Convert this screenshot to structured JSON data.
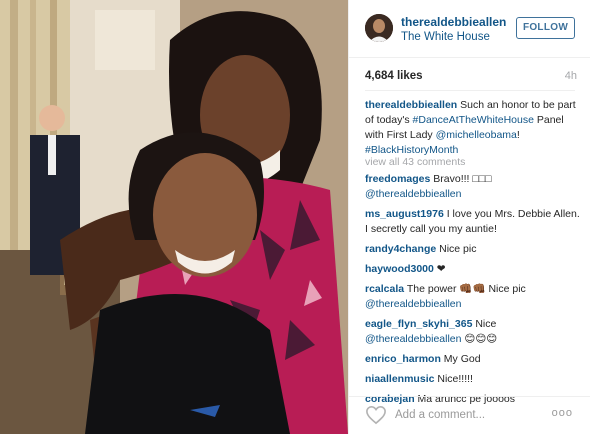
{
  "post": {
    "username": "therealdebbieallen",
    "location": "The White House",
    "follow_label": "FOLLOW",
    "likes": "4,684 likes",
    "time": "4h"
  },
  "caption": {
    "username": "therealdebbieallen",
    "text_1": " Such an honor to be part of today's ",
    "tag_1": "#DanceAtTheWhiteHouse",
    "text_2": " Panel with First Lady ",
    "mention": "@michelleobama",
    "text_3": "! ",
    "tag_2": "#BlackHistoryMonth"
  },
  "view_all": "view all 43 comments",
  "comments": [
    {
      "user": "freedomages",
      "pre": " Bravo!!! ",
      "mention": "@therealdebbieallen",
      "post": "",
      "emoji": "□□□"
    },
    {
      "user": "ms_august1976",
      "pre": " I love you Mrs. Debbie Allen. I secretly call you my auntie!",
      "mention": "",
      "post": "",
      "emoji": ""
    },
    {
      "user": "randy4change",
      "pre": " Nice pic",
      "mention": "",
      "post": "",
      "emoji": ""
    },
    {
      "user": "haywood3000",
      "pre": " ",
      "mention": "",
      "post": "",
      "emoji": "❤"
    },
    {
      "user": "rcalcala",
      "pre": " The power ",
      "mention": "@therealdebbieallen",
      "post": " Nice pic",
      "emoji": "👊🏾👊🏾"
    },
    {
      "user": "eagle_flyn_skyhi_365",
      "pre": " Nice ",
      "mention": "@therealdebbieallen",
      "post": "",
      "emoji": "😊😊😊"
    },
    {
      "user": "enrico_harmon",
      "pre": " My God",
      "mention": "",
      "post": "",
      "emoji": ""
    },
    {
      "user": "niaallenmusic",
      "pre": " Nice!!!!!",
      "mention": "",
      "post": "",
      "emoji": ""
    },
    {
      "user": "corabejan",
      "pre": " Ma aruncc pe joooos",
      "mention": "",
      "post": "",
      "emoji": ""
    }
  ],
  "add_comment": {
    "placeholder": "Add a comment...",
    "more": "ooo"
  },
  "icons": {
    "heart": "heart-outline-icon",
    "more": "more-options-icon",
    "avatar": "avatar"
  },
  "colors": {
    "link_blue": "#125688",
    "follow_border": "#3f729b",
    "muted": "#a5a7aa"
  }
}
